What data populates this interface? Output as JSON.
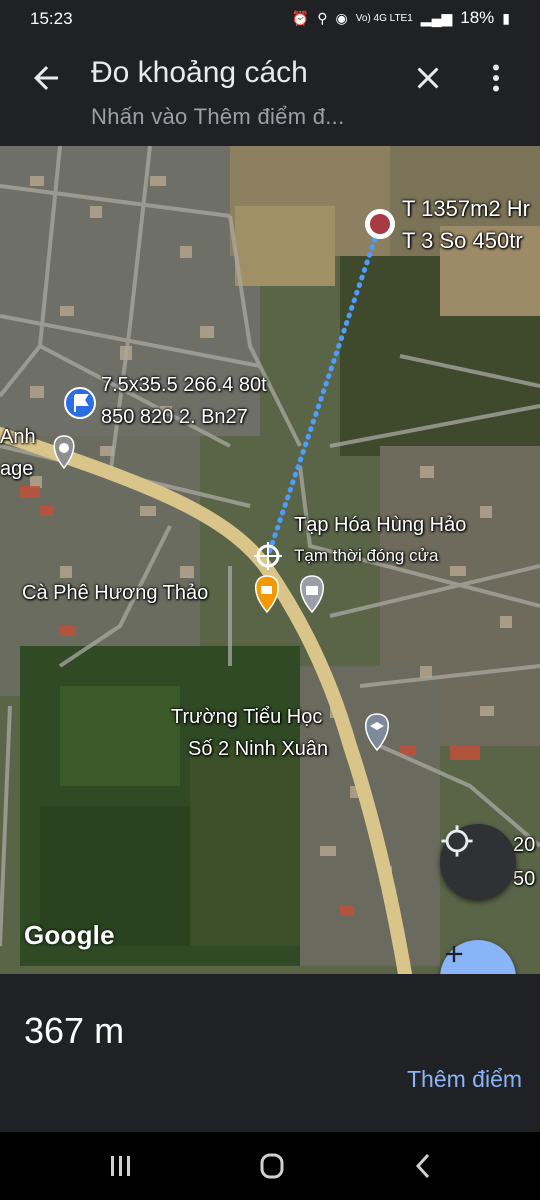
{
  "status": {
    "time": "15:23",
    "network": "Vo) 4G LTE1",
    "battery": "18%"
  },
  "appbar": {
    "title": "Đo khoảng cách",
    "subtitle": "Nhấn vào Thêm điểm đ..."
  },
  "map": {
    "labels": {
      "marker_line1": "T 1357m2 Hr",
      "marker_line2": "T 3 So 450tr",
      "flag_line1": "7.5x35.5 266.4 80t",
      "flag_line2": "850 820 2. Bn27",
      "anh": "Anh",
      "age": "age",
      "shop_name": "Tạp Hóa Hùng Hảo",
      "shop_status": "Tạm thời đóng cửa",
      "cafe": "Cà Phê Hương Thảo",
      "school_line1": "Trường Tiểu Học",
      "school_line2": "Số 2 Ninh Xuân",
      "edge_line1": "20",
      "edge_line2": "50"
    },
    "google_logo": "Google"
  },
  "measure": {
    "distance": "367 m",
    "add_point_label": "Thêm điểm"
  },
  "colors": {
    "bar": "#202124",
    "accent": "#8ab4f8",
    "road": "#d9c48a",
    "measure_line": "#4d9cff"
  }
}
